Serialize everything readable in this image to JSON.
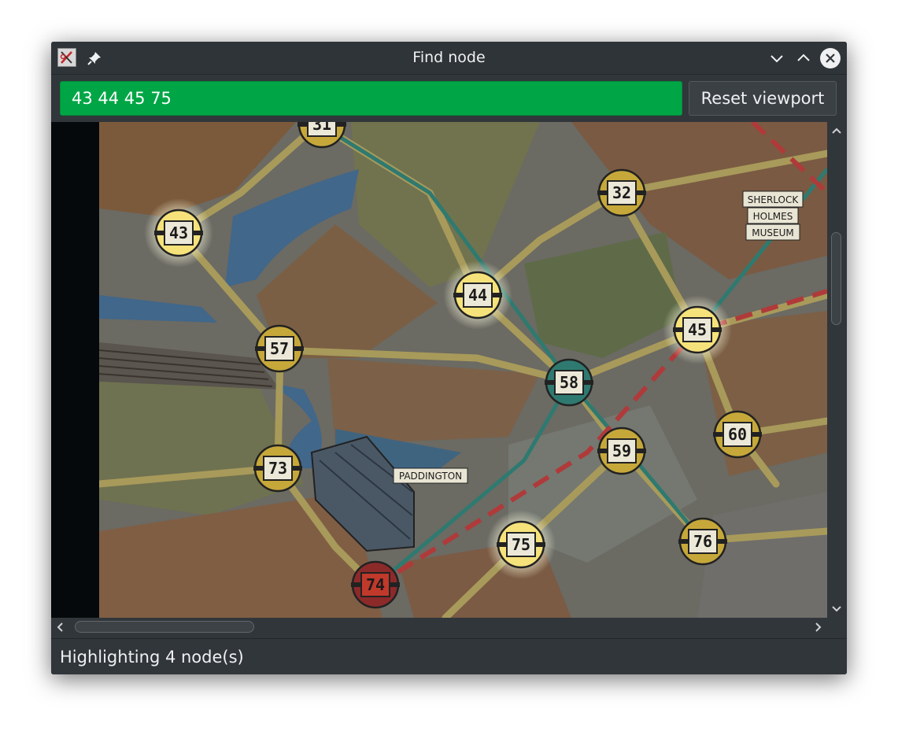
{
  "window": {
    "title": "Find node",
    "icons": [
      "app-icon",
      "pin-icon",
      "minimize-icon",
      "maximize-icon",
      "close-icon"
    ]
  },
  "search": {
    "value": "43 44 45 75"
  },
  "reset_button": {
    "label": "Reset viewport"
  },
  "map": {
    "highlighted_nodes": [
      "43",
      "44",
      "45",
      "75"
    ],
    "nodes": [
      {
        "id": "31",
        "label": "31",
        "type": "taxi"
      },
      {
        "id": "32",
        "label": "32",
        "type": "taxi"
      },
      {
        "id": "43",
        "label": "43",
        "type": "taxi"
      },
      {
        "id": "44",
        "label": "44",
        "type": "taxi"
      },
      {
        "id": "45",
        "label": "45",
        "type": "taxi"
      },
      {
        "id": "57",
        "label": "57",
        "type": "taxi"
      },
      {
        "id": "58",
        "label": "58",
        "type": "bus"
      },
      {
        "id": "59",
        "label": "59",
        "type": "taxi"
      },
      {
        "id": "60",
        "label": "60",
        "type": "taxi"
      },
      {
        "id": "73",
        "label": "73",
        "type": "taxi"
      },
      {
        "id": "74",
        "label": "74",
        "type": "underground"
      },
      {
        "id": "75",
        "label": "75",
        "type": "taxi"
      },
      {
        "id": "76",
        "label": "76",
        "type": "taxi"
      }
    ],
    "places": {
      "sherlock": [
        "SHERLOCK",
        "HOLMES",
        "MUSEUM"
      ],
      "paddington": "PADDINGTON"
    }
  },
  "status": {
    "text": "Highlighting 4 node(s)"
  },
  "colors": {
    "search_match": "#00a645",
    "chrome": "#31363b",
    "highlight": "#fff3a0"
  }
}
